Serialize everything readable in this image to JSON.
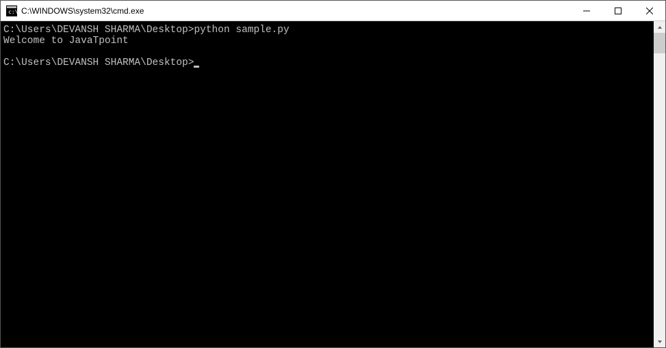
{
  "window": {
    "title": "C:\\WINDOWS\\system32\\cmd.exe"
  },
  "terminal": {
    "lines": [
      {
        "prompt": "C:\\Users\\DEVANSH SHARMA\\Desktop>",
        "command": "python sample.py"
      },
      {
        "output": "Welcome to JavaTpoint"
      },
      {
        "output": ""
      },
      {
        "prompt": "C:\\Users\\DEVANSH SHARMA\\Desktop>",
        "cursor": true
      }
    ]
  }
}
